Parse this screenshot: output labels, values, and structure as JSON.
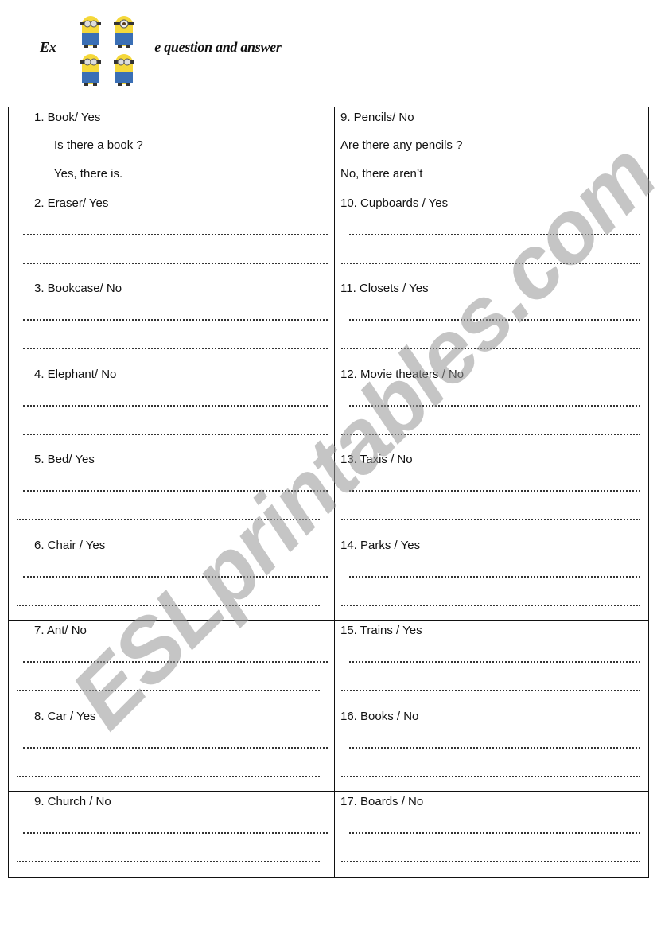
{
  "header": {
    "title": "Exercise: Make question and answer",
    "title_visible": "Ex       e question and answer",
    "image_label": "minions-image"
  },
  "worksheet": {
    "left_column": [
      {
        "label": "1. Book/ Yes",
        "question": "Is there a book ?",
        "answer": "Yes, there is."
      },
      {
        "label": "2.  Eraser/ Yes"
      },
      {
        "label": "3. Bookcase/ No"
      },
      {
        "label": "4. Elephant/ No"
      },
      {
        "label": "5. Bed/ Yes"
      },
      {
        "label": "6. Chair / Yes"
      },
      {
        "label": "7. Ant/ No"
      },
      {
        "label": "8. Car / Yes"
      },
      {
        "label": "9. Church / No"
      }
    ],
    "right_column": [
      {
        "label": "9. Pencils/ No",
        "question": "Are there any pencils ?",
        "answer": "No, there aren’t"
      },
      {
        "label": "10.  Cupboards / Yes"
      },
      {
        "label": "11. Closets / Yes"
      },
      {
        "label": "12. Movie theaters / No"
      },
      {
        "label": "13. Taxis / No"
      },
      {
        "label": "14. Parks / Yes"
      },
      {
        "label": "15. Trains / Yes"
      },
      {
        "label": "16. Books / No"
      },
      {
        "label": "17. Boards / No"
      }
    ]
  },
  "watermark": {
    "text": "ESLprintables.com"
  },
  "colors": {
    "minion_yellow": "#f5d83a",
    "minion_blue": "#3a6fb5",
    "watermark_gray": "#9a9a9a"
  }
}
